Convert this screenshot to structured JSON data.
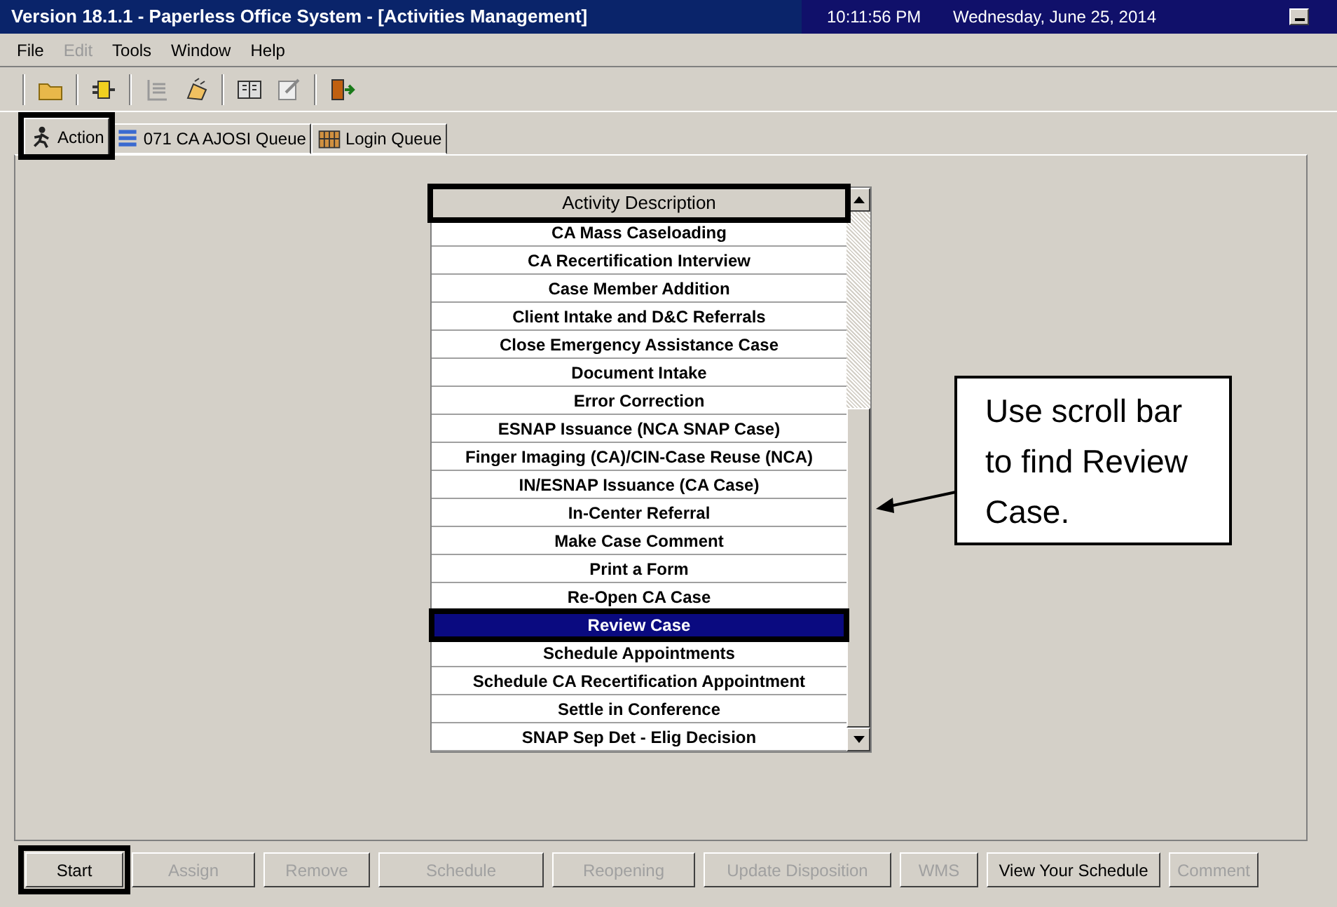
{
  "window": {
    "title": "Version 18.1.1 - Paperless Office System - [Activities Management]",
    "time": "10:11:56 PM",
    "date": "Wednesday, June 25, 2014"
  },
  "menu": [
    {
      "label": "File",
      "disabled": false
    },
    {
      "label": "Edit",
      "disabled": true
    },
    {
      "label": "Tools",
      "disabled": false
    },
    {
      "label": "Window",
      "disabled": false
    },
    {
      "label": "Help",
      "disabled": false
    }
  ],
  "tabs": [
    {
      "label": "Action",
      "selected": true,
      "annotated": true
    },
    {
      "label": "071 CA AJOSI Queue",
      "selected": false,
      "annotated": false
    },
    {
      "label": "Login Queue",
      "selected": false,
      "annotated": false
    }
  ],
  "list": {
    "header": {
      "label": "Activity Description",
      "annotated": true
    },
    "items": [
      {
        "label": "CA Mass Caseloading",
        "selected": false,
        "annotated": false
      },
      {
        "label": "CA Recertification Interview",
        "selected": false,
        "annotated": false
      },
      {
        "label": "Case Member Addition",
        "selected": false,
        "annotated": false
      },
      {
        "label": "Client Intake and D&C Referrals",
        "selected": false,
        "annotated": false
      },
      {
        "label": "Close Emergency Assistance Case",
        "selected": false,
        "annotated": false
      },
      {
        "label": "Document Intake",
        "selected": false,
        "annotated": false
      },
      {
        "label": "Error Correction",
        "selected": false,
        "annotated": false
      },
      {
        "label": "ESNAP Issuance (NCA SNAP Case)",
        "selected": false,
        "annotated": false
      },
      {
        "label": "Finger Imaging (CA)/CIN-Case Reuse (NCA)",
        "selected": false,
        "annotated": false
      },
      {
        "label": "IN/ESNAP Issuance (CA Case)",
        "selected": false,
        "annotated": false
      },
      {
        "label": "In-Center Referral",
        "selected": false,
        "annotated": false
      },
      {
        "label": "Make Case Comment",
        "selected": false,
        "annotated": false
      },
      {
        "label": "Print a Form",
        "selected": false,
        "annotated": false
      },
      {
        "label": "Re-Open CA Case",
        "selected": false,
        "annotated": false
      },
      {
        "label": "Review Case",
        "selected": true,
        "annotated": true
      },
      {
        "label": "Schedule Appointments",
        "selected": false,
        "annotated": false
      },
      {
        "label": "Schedule CA Recertification Appointment",
        "selected": false,
        "annotated": false
      },
      {
        "label": "Settle in Conference",
        "selected": false,
        "annotated": false
      },
      {
        "label": "SNAP Sep Det - Elig Decision",
        "selected": false,
        "annotated": false
      }
    ]
  },
  "callout": {
    "text": "Use scroll bar to find Review Case."
  },
  "buttons": [
    {
      "label": "Start",
      "disabled": false,
      "annotated": true
    },
    {
      "label": "Assign",
      "disabled": true,
      "annotated": false
    },
    {
      "label": "Remove",
      "disabled": true,
      "annotated": false
    },
    {
      "label": "Schedule",
      "disabled": true,
      "annotated": false
    },
    {
      "label": "Reopening",
      "disabled": true,
      "annotated": false
    },
    {
      "label": "Update Disposition",
      "disabled": true,
      "annotated": false
    },
    {
      "label": "WMS",
      "disabled": true,
      "annotated": false
    },
    {
      "label": "View Your Schedule",
      "disabled": false,
      "annotated": false
    },
    {
      "label": "Comment",
      "disabled": true,
      "annotated": false
    }
  ]
}
